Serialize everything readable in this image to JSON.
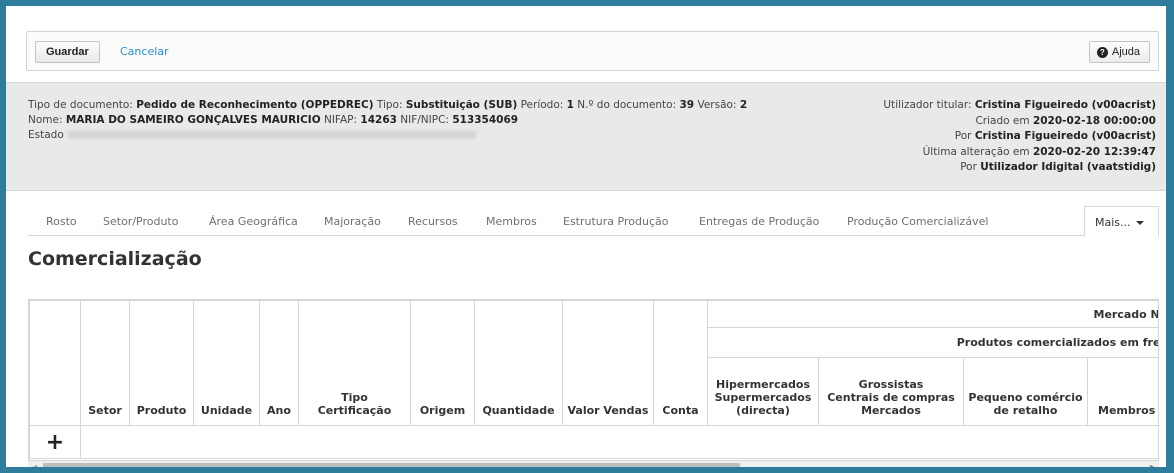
{
  "toolbar": {
    "save_label": "Guardar",
    "cancel_label": "Cancelar",
    "help_label": "Ajuda",
    "help_icon": "question-circle-icon"
  },
  "info": {
    "left": {
      "doc_type_label": "Tipo de documento:",
      "doc_type_value": "Pedido de Reconhecimento (OPPEDREC)",
      "type_label": "Tipo:",
      "type_value": "Substituição (SUB)",
      "period_label": "Período:",
      "period_value": "1",
      "doc_number_label": "N.º do documento:",
      "doc_number_value": "39",
      "version_label": "Versão:",
      "version_value": "2",
      "name_label": "Nome:",
      "name_value": "MARIA DO SAMEIRO GONÇALVES MAURICIO",
      "nifap_label": "NIFAP:",
      "nifap_value": "14263",
      "nif_label": "NIF/NIPC:",
      "nif_value": "513354069",
      "state_label": "Estado"
    },
    "right": {
      "owner_label": "Utilizador titular:",
      "owner_value": "Cristina Figueiredo (v00acrist)",
      "created_label": "Criado em",
      "created_value": "2020-02-18 00:00:00",
      "created_by_label": "Por",
      "created_by_value": "Cristina Figueiredo (v00acrist)",
      "modified_label": "Última alteração em",
      "modified_value": "2020-02-20 12:39:47",
      "modified_by_label": "Por",
      "modified_by_value": "Utilizador Idigital (vaatstidig)"
    }
  },
  "tabs": [
    "Rosto",
    "Setor/Produto",
    "Área Geográfica",
    "Majoração",
    "Recursos",
    "Membros",
    "Estrutura Produção",
    "Entregas de Produção",
    "Produção Comercializável"
  ],
  "more_tab_label": "Mais...",
  "page_title": "Comercialização",
  "table": {
    "group_header": "Mercado Nacional",
    "sub_group_header": "Produtos comercializados em fresco",
    "columns": [
      "Setor",
      "Produto",
      "Unidade",
      "Ano",
      "Tipo Certificação",
      "Origem",
      "Quantidade",
      "Valor Vendas",
      "Conta"
    ],
    "market_columns": [
      [
        "Hipermercados",
        "Supermercados",
        "(directa)"
      ],
      [
        "Grossistas",
        "Centrais de compras",
        "Mercados"
      ],
      [
        "Pequeno comércio",
        "de retalho"
      ],
      [
        "Membros"
      ]
    ],
    "add_row_icon": "plus-icon"
  }
}
